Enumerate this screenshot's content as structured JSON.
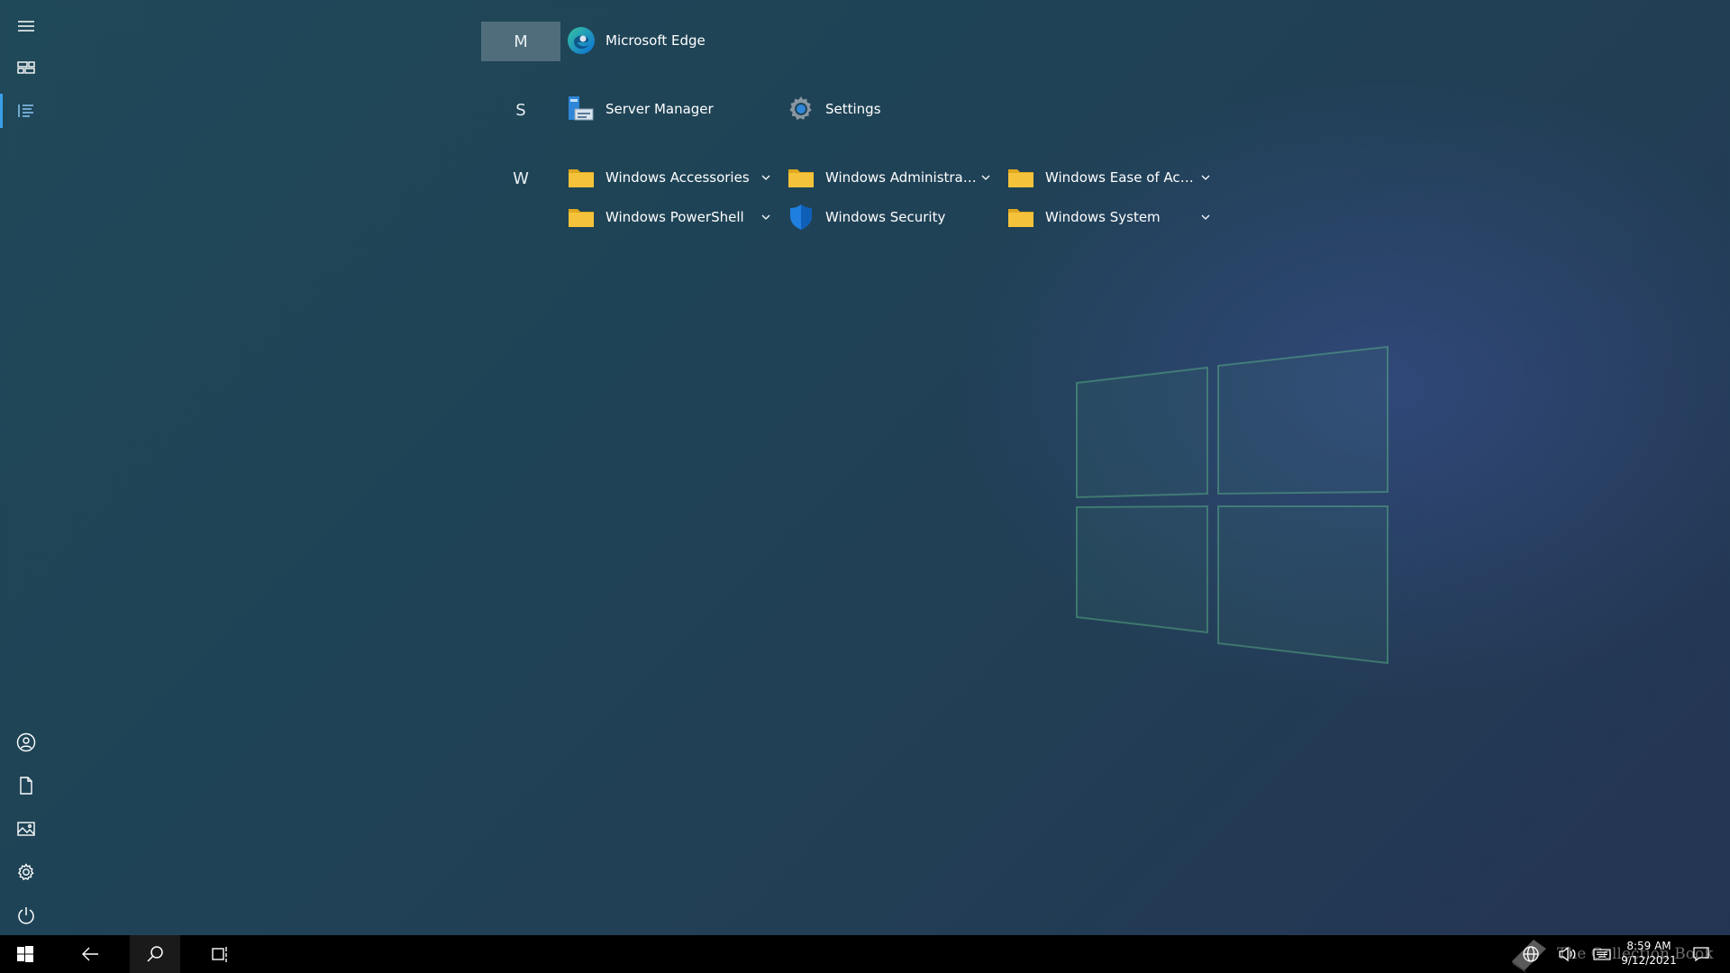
{
  "start_menu": {
    "groups": [
      {
        "letter": "M",
        "selected": true,
        "apps": [
          {
            "label": "Microsoft Edge",
            "icon": "edge-icon"
          }
        ]
      },
      {
        "letter": "S",
        "selected": false,
        "apps": [
          {
            "label": "Server Manager",
            "icon": "server-manager-icon"
          },
          {
            "label": "Settings",
            "icon": "gear-icon"
          }
        ]
      },
      {
        "letter": "W",
        "selected": false,
        "apps": [
          {
            "label": "Windows Accessories",
            "icon": "folder-icon",
            "expandable": true
          },
          {
            "label": "Windows Administrativ...",
            "icon": "folder-icon",
            "expandable": true
          },
          {
            "label": "Windows Ease of Access",
            "icon": "folder-icon",
            "expandable": true
          },
          {
            "label": "Windows PowerShell",
            "icon": "folder-icon",
            "expandable": true
          },
          {
            "label": "Windows Security",
            "icon": "shield-icon"
          },
          {
            "label": "Windows System",
            "icon": "folder-icon",
            "expandable": true
          }
        ]
      }
    ]
  },
  "rail": {
    "top": [
      "hamburger-icon",
      "tiles-icon",
      "all-apps-list-icon"
    ],
    "bottom": [
      "user-icon",
      "document-icon",
      "pictures-icon",
      "gear-icon",
      "power-icon"
    ]
  },
  "taskbar": {
    "buttons": [
      "windows-logo-icon",
      "back-arrow-icon",
      "search-icon",
      "task-view-icon"
    ],
    "tray": [
      "network-icon",
      "volume-icon",
      "keyboard-icon",
      "notification-icon"
    ],
    "time": "8:59 AM",
    "date": "9/12/2021",
    "watermark": "The Collection Book"
  },
  "colors": {
    "accent": "#3a9ee9",
    "folder": "#f5c33b",
    "taskbar": "#000000"
  }
}
